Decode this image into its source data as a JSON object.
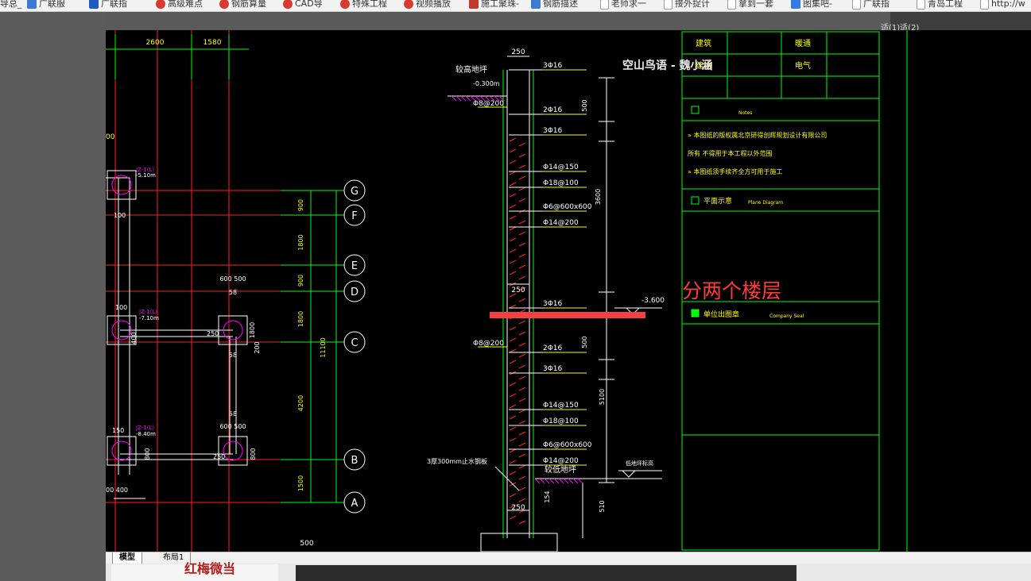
{
  "bookmarks": [
    {
      "label": "导总_",
      "icon": "file-icon"
    },
    {
      "label": "广联服",
      "icon": "glodon-icon"
    },
    {
      "label": "广联指",
      "icon": "g-icon"
    },
    {
      "label": "高级难点",
      "icon": "red-logo-icon"
    },
    {
      "label": "钢筋算量",
      "icon": "red-logo-icon"
    },
    {
      "label": "CAD导",
      "icon": "red-logo-icon"
    },
    {
      "label": "特殊工程",
      "icon": "red-logo-icon"
    },
    {
      "label": "视频播放",
      "icon": "red-logo-icon"
    },
    {
      "label": "施工聚珠-",
      "icon": "dark-logo-icon"
    },
    {
      "label": "钢筋描述",
      "icon": "glodon-icon"
    },
    {
      "label": "老师求一",
      "icon": "file-icon"
    },
    {
      "label": "接外捉计",
      "icon": "file-icon"
    },
    {
      "label": "拿到一套",
      "icon": "file-icon"
    },
    {
      "label": "图集吧-",
      "icon": "picture-icon"
    },
    {
      "label": "广联指",
      "icon": "file-icon"
    },
    {
      "label": "青岛工程",
      "icon": "file-icon"
    },
    {
      "label": "http://w",
      "icon": "file-icon"
    }
  ],
  "overlay": {
    "watermark": "空山鸟语 - 魏小涵",
    "annotation": "分两个楼层"
  },
  "tabs": {
    "model": "模型",
    "layout1": "布局1"
  },
  "background": {
    "bottom_title": "红梅微当",
    "top_right": "适(1)适(2)"
  },
  "drawing": {
    "axis_labels": [
      "G",
      "F",
      "E",
      "D",
      "C",
      "B",
      "A"
    ],
    "dims_top": [
      "2600",
      "1580"
    ],
    "dims_right": [
      "900",
      "1800",
      "900",
      "1800",
      "4200",
      "1500"
    ],
    "total_dim": "11100",
    "left_small": [
      "00",
      "100",
      "100",
      "400",
      "150",
      "00 400",
      "200",
      "1800",
      "300",
      "250",
      "58",
      "58",
      "58"
    ],
    "col_marks": [
      "600 500",
      "600 500"
    ],
    "elev_labels": [
      "JZ-1(L)",
      "-5.10m",
      "-7.10m",
      "-8.40m"
    ],
    "section": {
      "high_floor": "较高地坪",
      "high_elev": "-0.300m",
      "low_floor": "较低地坪",
      "low_elev": "-3.600",
      "low_ground_label": "低地坪标高",
      "stop_water": "3厚300mm止水钢板",
      "rebar": [
        "3Φ16",
        "2Φ16",
        "3Φ16",
        "Φ14@150",
        "Φ18@100",
        "Φ6@600x600",
        "Φ14@200"
      ],
      "rebar2": [
        "3Φ16",
        "2Φ16",
        "3Φ16",
        "Φ14@150",
        "Φ18@100",
        "Φ6@600x600",
        "Φ14@200"
      ],
      "stir": "Φ8@200",
      "widths": [
        "250",
        "250",
        "250",
        "500"
      ],
      "heights": [
        "500",
        "3600",
        "500",
        "5100",
        "510",
        "154"
      ]
    },
    "title_block": {
      "row1": [
        "建筑",
        "",
        "暖通",
        ""
      ],
      "row2": [
        "结构",
        "",
        "电气",
        ""
      ],
      "notes_title": "Notes",
      "notes": [
        "本图纸的版权属北京研得创辉规划设计有限公司",
        "所有  不得用于本工程以外范围",
        "本图纸须手续齐全方可用于施工"
      ],
      "plane_title": "平面示意",
      "plane_en": "Plane Diagram",
      "seal_title": "单位出图章",
      "seal_en": "Company Seal"
    }
  }
}
